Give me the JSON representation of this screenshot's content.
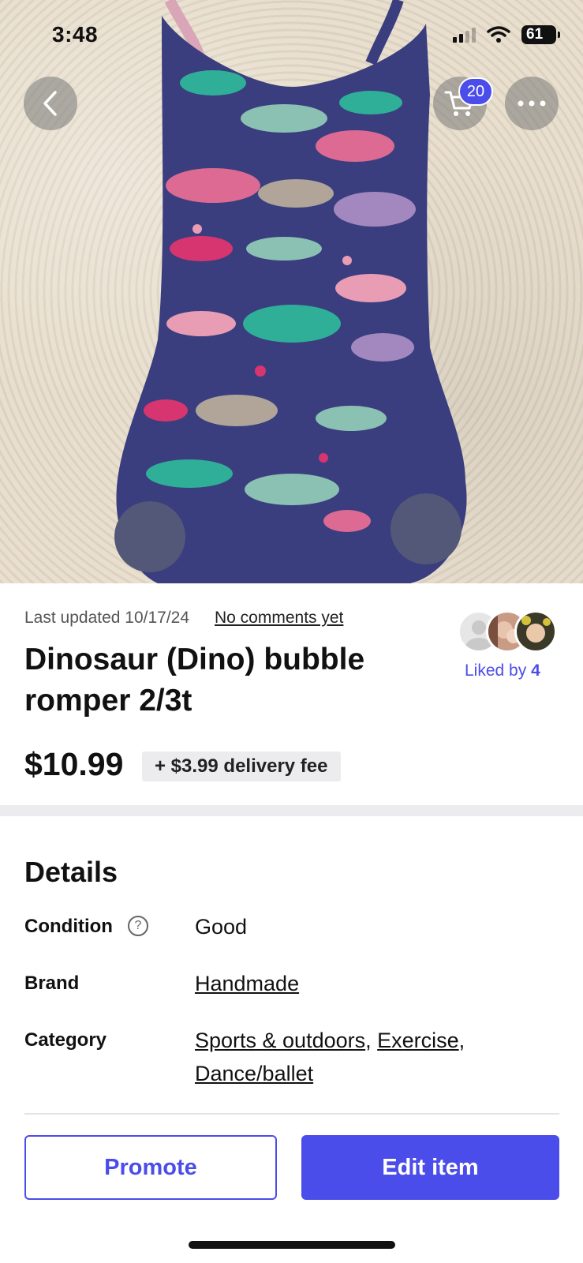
{
  "status_bar": {
    "time": "3:48",
    "battery": "61"
  },
  "nav": {
    "cart_count": "20"
  },
  "listing": {
    "last_updated": "Last updated 10/17/24",
    "comments_link": "No comments yet",
    "title": "Dinosaur (Dino) bubble romper 2/3t",
    "liked_by_label": "Liked by",
    "liked_by_count": "4",
    "price": "$10.99",
    "delivery_fee": "+ $3.99 delivery fee"
  },
  "details": {
    "heading": "Details",
    "condition_label": "Condition",
    "condition_value": "Good",
    "brand_label": "Brand",
    "brand_value": "Handmade",
    "category_label": "Category",
    "category_values": [
      "Sports & outdoors",
      "Exercise",
      "Dance/ballet"
    ]
  },
  "actions": {
    "promote": "Promote",
    "edit": "Edit item"
  },
  "colors": {
    "accent": "#4b4dea",
    "romper_base": "#3a3e7e"
  },
  "icons": [
    "back-chevron-icon",
    "cart-icon",
    "more-dots-icon",
    "help-circle-icon",
    "wifi-icon",
    "signal-icon",
    "battery-icon"
  ]
}
